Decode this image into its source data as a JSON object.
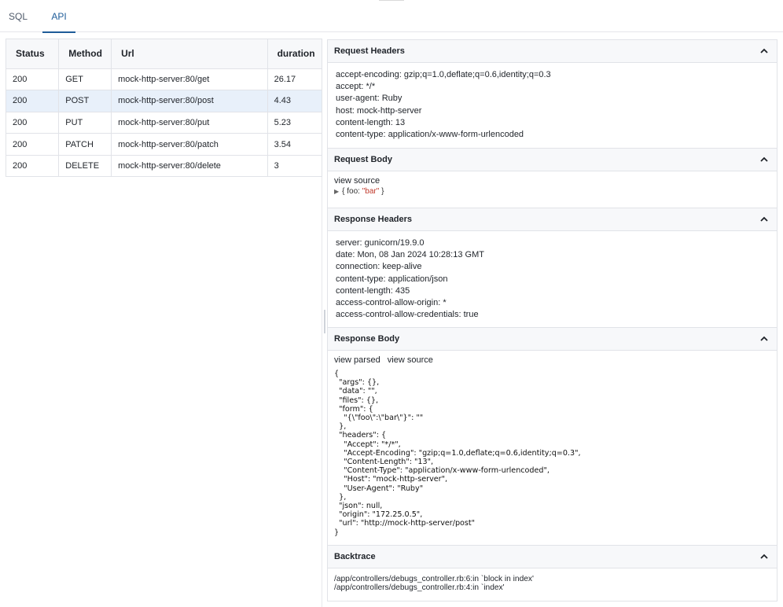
{
  "tabs": [
    "SQL",
    "API"
  ],
  "table": {
    "headers": [
      "Status",
      "Method",
      "Url",
      "duration"
    ],
    "rows": [
      [
        "200",
        "GET",
        "mock-http-server:80/get",
        "26.17"
      ],
      [
        "200",
        "POST",
        "mock-http-server:80/post",
        "4.43"
      ],
      [
        "200",
        "PUT",
        "mock-http-server:80/put",
        "5.23"
      ],
      [
        "200",
        "PATCH",
        "mock-http-server:80/patch",
        "3.54"
      ],
      [
        "200",
        "DELETE",
        "mock-http-server:80/delete",
        "3"
      ]
    ]
  },
  "request_headers": {
    "title": "Request Headers",
    "lines": [
      "accept-encoding: gzip;q=1.0,deflate;q=0.6,identity;q=0.3",
      "accept: */*",
      "user-agent: Ruby",
      "host: mock-http-server",
      "content-length: 13",
      "content-type: application/x-www-form-urlencoded"
    ]
  },
  "request_body": {
    "title": "Request Body",
    "view_source": "view source",
    "prefix": "{ foo: ",
    "value": "\"bar\"",
    "suffix": " }"
  },
  "response_headers": {
    "title": "Response Headers",
    "lines": [
      "server: gunicorn/19.9.0",
      "date: Mon, 08 Jan 2024 10:28:13 GMT",
      "connection: keep-alive",
      "content-type: application/json",
      "content-length: 435",
      "access-control-allow-origin: *",
      "access-control-allow-credentials: true"
    ]
  },
  "response_body": {
    "title": "Response Body",
    "view_parsed": "view parsed",
    "view_source": "view source",
    "json": "{\n  \"args\": {},\n  \"data\": \"\",\n  \"files\": {},\n  \"form\": {\n    \"{\\\"foo\\\":\\\"bar\\\"}\": \"\"\n  },\n  \"headers\": {\n    \"Accept\": \"*/*\",\n    \"Accept-Encoding\": \"gzip;q=1.0,deflate;q=0.6,identity;q=0.3\",\n    \"Content-Length\": \"13\",\n    \"Content-Type\": \"application/x-www-form-urlencoded\",\n    \"Host\": \"mock-http-server\",\n    \"User-Agent\": \"Ruby\"\n  },\n  \"json\": null,\n  \"origin\": \"172.25.0.5\",\n  \"url\": \"http://mock-http-server/post\"\n}"
  },
  "backtrace": {
    "title": "Backtrace",
    "lines": [
      "/app/controllers/debugs_controller.rb:6:in `block in index'",
      "/app/controllers/debugs_controller.rb:4:in `index'"
    ]
  },
  "icons": {
    "collapse": "chevron-up-icon",
    "expand_source": "triangle-right-icon"
  },
  "colors": {
    "accent": "#1f5c99",
    "selected_row": "#e8f0fa",
    "string": "#c0392b"
  }
}
